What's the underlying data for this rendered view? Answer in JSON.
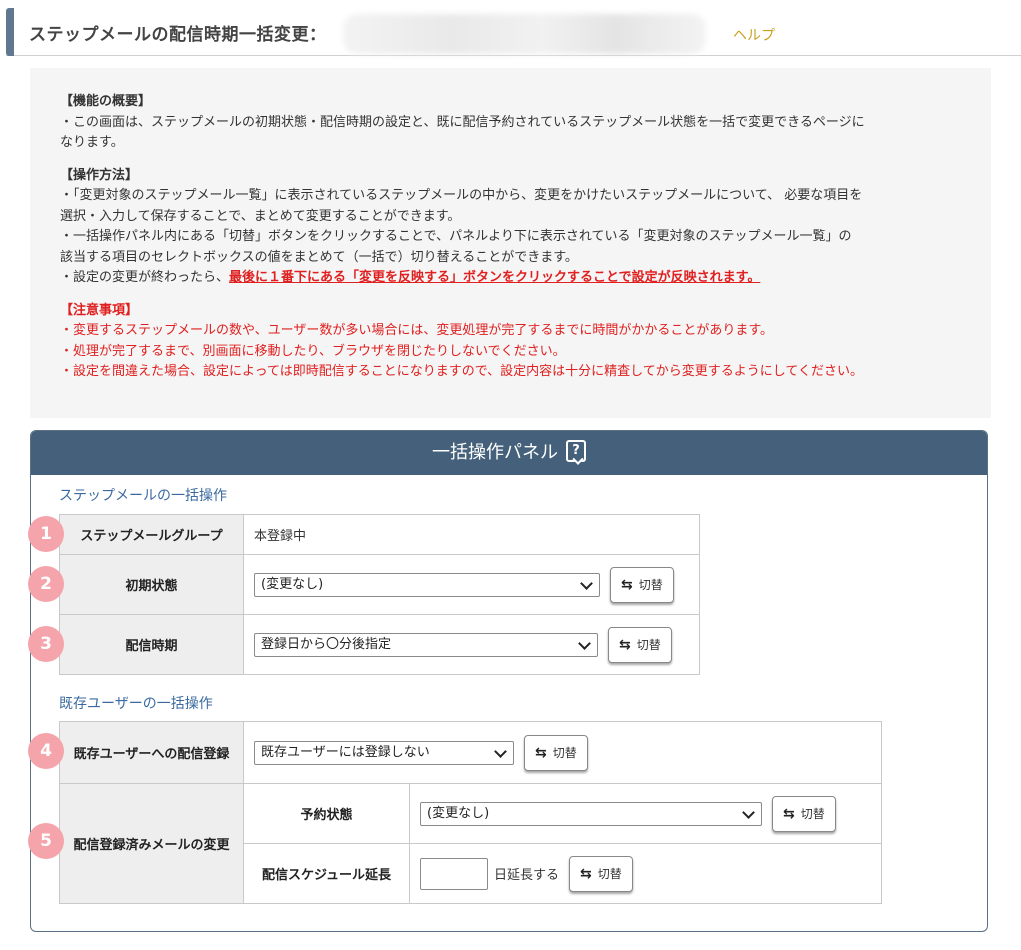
{
  "header": {
    "title": "ステップメールの配信時期一括変更：",
    "help_label": "ヘルプ"
  },
  "info": {
    "overview_title": "【機能の概要】",
    "overview_lines": [
      "・この画面は、ステップメールの初期状態・配信時期の設定と、既に配信予約されているステップメール状態を一括で変更できるページに",
      "なります。"
    ],
    "method_title": "【操作方法】",
    "method_lines": [
      "・「変更対象のステップメール一覧」に表示されているステップメールの中から、変更をかけたいステップメールについて、 必要な項目を",
      "選択・入力して保存することで、まとめて変更することができます。",
      "・一括操作パネル内にある「切替」ボタンをクリックすることで、パネルより下に表示されている「変更対象のステップメール一覧」の",
      "該当する項目のセレクトボックスの値をまとめて（一括で）切り替えることができます。"
    ],
    "method_last_prefix": "・設定の変更が終わったら、",
    "method_last_emphasis": "最後に１番下にある「変更を反映する」ボタンをクリックすることで設定が反映されます。",
    "caution_title": "【注意事項】",
    "caution_lines": [
      "・変更するステップメールの数や、ユーザー数が多い場合には、変更処理が完了するまでに時間がかかることがあります。",
      "・処理が完了するまで、別画面に移動したり、ブラウザを閉じたりしないでください。",
      "・設定を間違えた場合、設定によっては即時配信することになりますので、設定内容は十分に精査してから変更するようにしてください。"
    ]
  },
  "panel": {
    "title": "一括操作パネル",
    "help_icon_glyph": "?",
    "step_section_title": "ステップメールの一括操作",
    "existing_section_title": "既存ユーザーの一括操作",
    "toggle_label": "切替",
    "toggle_icon_glyph": "⇆",
    "rows": {
      "group_label": "ステップメールグループ",
      "group_value": "本登録中",
      "initial_state_label": "初期状態",
      "initial_state_value": "(変更なし)",
      "timing_label": "配信時期",
      "timing_value": "登録日から〇分後指定",
      "existing_reg_label": "既存ユーザーへの配信登録",
      "existing_reg_value": "既存ユーザーには登録しない",
      "registered_change_label": "配信登録済みメールの変更",
      "reservation_label": "予約状態",
      "reservation_value": "(変更なし)",
      "extend_label": "配信スケジュール延長",
      "extend_value": "",
      "extend_suffix": "日延長する"
    },
    "badges": [
      "1",
      "2",
      "3",
      "4",
      "5"
    ]
  },
  "colors": {
    "panel_header": "#44607a",
    "help_link": "#c9a120",
    "section_title": "#3b6aa0",
    "warning_red": "#e02020",
    "badge": "#f4a4aa"
  }
}
